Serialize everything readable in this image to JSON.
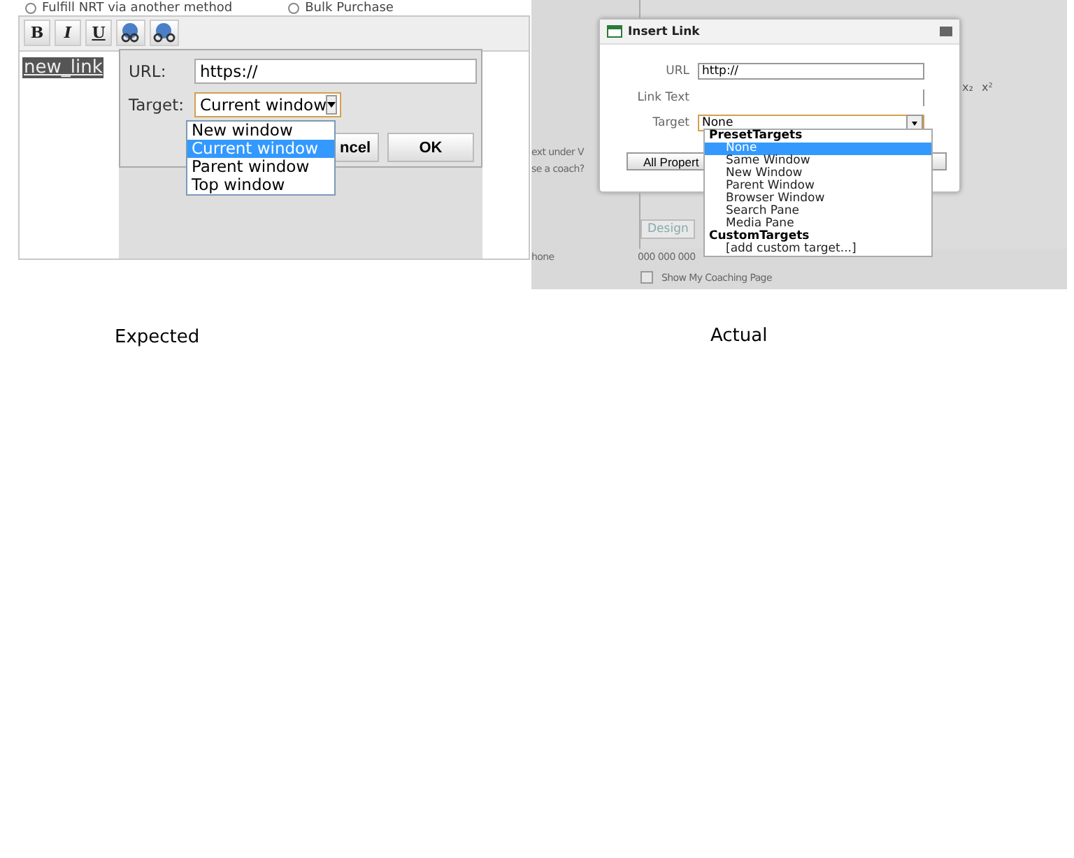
{
  "expected": {
    "radios": [
      {
        "label": "Fulfill NRT via another method",
        "selected": false
      },
      {
        "label": "Bulk Purchase",
        "selected": false
      }
    ],
    "format_buttons": [
      {
        "label": "B",
        "kind": "bold"
      },
      {
        "label": "I",
        "kind": "italic"
      },
      {
        "label": "U",
        "kind": "underline"
      }
    ],
    "content": "new_link",
    "dialog": {
      "url_label": "URL:",
      "url_value": "https://",
      "target_label": "Target:",
      "target_value": "Current window",
      "options": [
        {
          "label": "New window",
          "selected": false
        },
        {
          "label": "Current window",
          "selected": true
        },
        {
          "label": "Parent window",
          "selected": false
        },
        {
          "label": "Top window",
          "selected": false
        }
      ],
      "cancel": "ncel",
      "ok": "OK"
    },
    "caption": "Expected"
  },
  "actual": {
    "background": {
      "texts": [
        "ext under V",
        "se a coach?"
      ],
      "phone_label": "hone",
      "phone_value": "000 000 000",
      "tab": "Design",
      "tools": [
        "x₂",
        "x²"
      ],
      "checkbox": {
        "label": "Show My Coaching Page",
        "checked": false
      }
    },
    "dialog": {
      "title": "Insert Link",
      "url_label": "URL",
      "url_value": "http://",
      "link_text_label": "Link Text",
      "target_label": "Target",
      "target_value": "None",
      "properties_button": "All Propert",
      "groups": [
        {
          "label": "PresetTargets",
          "options": [
            {
              "label": "None",
              "selected": true
            },
            {
              "label": "Same Window",
              "selected": false
            },
            {
              "label": "New Window",
              "selected": false
            },
            {
              "label": "Parent Window",
              "selected": false
            },
            {
              "label": "Browser Window",
              "selected": false
            },
            {
              "label": "Search Pane",
              "selected": false
            },
            {
              "label": "Media Pane",
              "selected": false
            }
          ]
        },
        {
          "label": "CustomTargets",
          "options": [
            {
              "label": "[add custom target...]",
              "selected": false
            }
          ]
        }
      ]
    },
    "caption": "Actual"
  }
}
